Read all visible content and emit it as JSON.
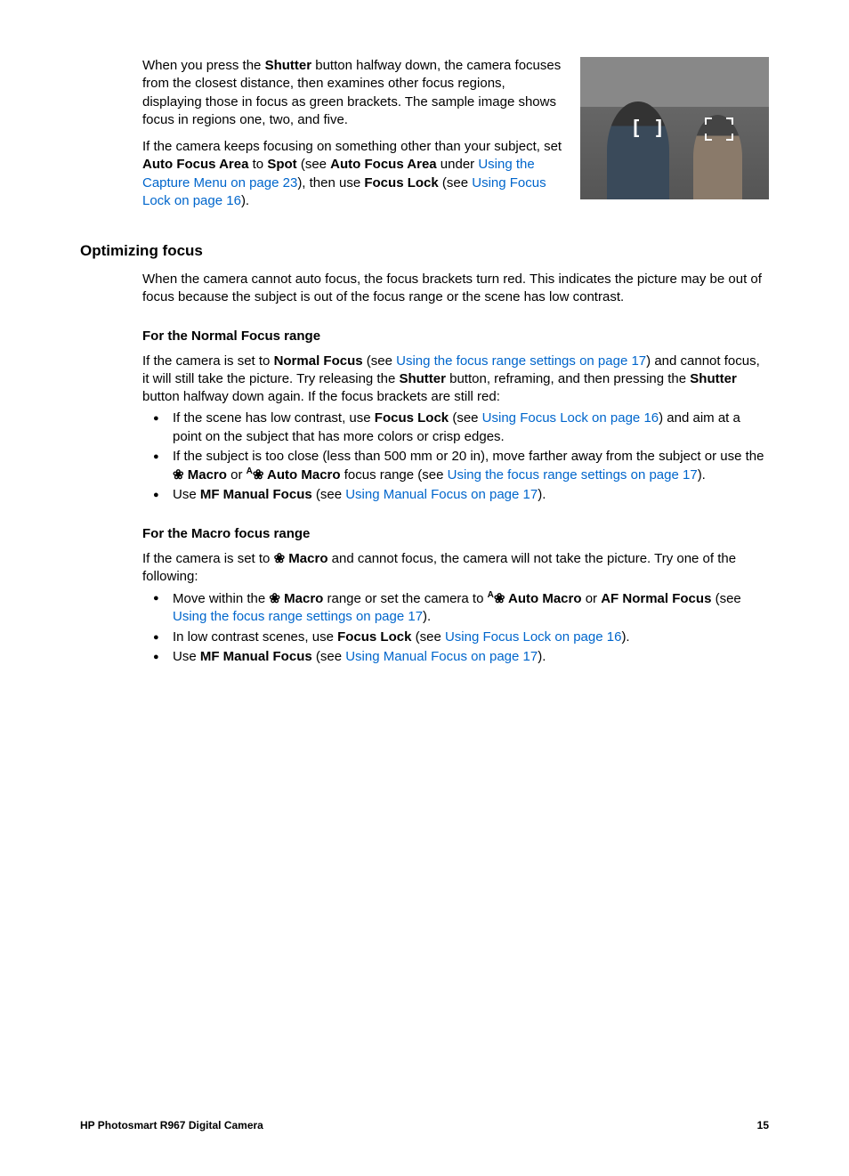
{
  "p1a": "When you press the ",
  "p1b": "Shutter",
  "p1c": " button halfway down, the camera focuses from the closest distance, then examines other focus regions, displaying those in focus as green brackets. The sample image shows focus in regions one, two, and five.",
  "p2a": "If the camera keeps focusing on something other than your subject, set ",
  "p2b": "Auto Focus Area",
  "p2c": " to ",
  "p2d": "Spot",
  "p2e": " (see ",
  "p2f": "Auto Focus Area",
  "p2g": " under ",
  "p2h": "Using the Capture Menu",
  "p2i": " on page 23",
  "p2j": "), then use ",
  "p2k": "Focus Lock",
  "p2l": " (see ",
  "p2m": "Using Focus Lock",
  "p2n": " on page 16",
  "p2o": ").",
  "h2": "Optimizing focus",
  "p3": "When the camera cannot auto focus, the focus brackets turn red. This indicates the picture may be out of focus because the subject is out of the focus range or the scene has low contrast.",
  "h3a": "For the Normal Focus range",
  "p4a": "If the camera is set to ",
  "p4b": "Normal Focus",
  "p4c": " (see ",
  "p4d": "Using the focus range settings",
  "p4e": " on page 17",
  "p4f": ") and cannot focus, it will still take the picture. Try releasing the ",
  "p4g": "Shutter",
  "p4h": " button, reframing, and then pressing the ",
  "p4i": "Shutter",
  "p4j": " button halfway down again. If the focus brackets are still red:",
  "li1a": "If the scene has low contrast, use ",
  "li1b": "Focus Lock",
  "li1c": " (see ",
  "li1d": "Using Focus Lock",
  "li1e": " on page 16",
  "li1f": ") and aim at a point on the subject that has more colors or crisp edges.",
  "li2a": "If the subject is too close (less than 500 mm or 20 in), move farther away from the subject or use the ",
  "li2b": " Macro",
  "li2c": " or ",
  "li2d": " Auto Macro",
  "li2e": " focus range (see ",
  "li2f": "Using the focus range settings",
  "li2g": " on page 17",
  "li2h": ").",
  "li3a": "Use ",
  "li3b": "MF",
  "li3c": " Manual Focus",
  "li3d": " (see ",
  "li3e": "Using Manual Focus",
  "li3f": " on page 17",
  "li3g": ").",
  "h3b": "For the Macro focus range",
  "p5a": "If the camera is set to ",
  "p5b": " Macro",
  "p5c": " and cannot focus, the camera will not take the picture. Try one of the following:",
  "li4a": "Move within the ",
  "li4b": " Macro",
  "li4c": " range or set the camera to ",
  "li4d": " Auto Macro",
  "li4e": " or ",
  "li4f": "AF",
  "li4g": " Normal Focus",
  "li4h": " (see ",
  "li4i": "Using the focus range settings",
  "li4j": " on page 17",
  "li4k": ").",
  "li5a": "In low contrast scenes, use ",
  "li5b": "Focus Lock",
  "li5c": " (see ",
  "li5d": "Using Focus Lock",
  "li5e": " on page 16",
  "li5f": ").",
  "li6a": "Use ",
  "li6b": "MF",
  "li6c": " Manual Focus",
  "li6d": " (see ",
  "li6e": "Using Manual Focus",
  "li6f": " on page 17",
  "li6g": ").",
  "footer_left": "HP Photosmart R967 Digital Camera",
  "footer_right": "15",
  "icon_macro": "❀",
  "icon_auto_macro_prefix": "A"
}
